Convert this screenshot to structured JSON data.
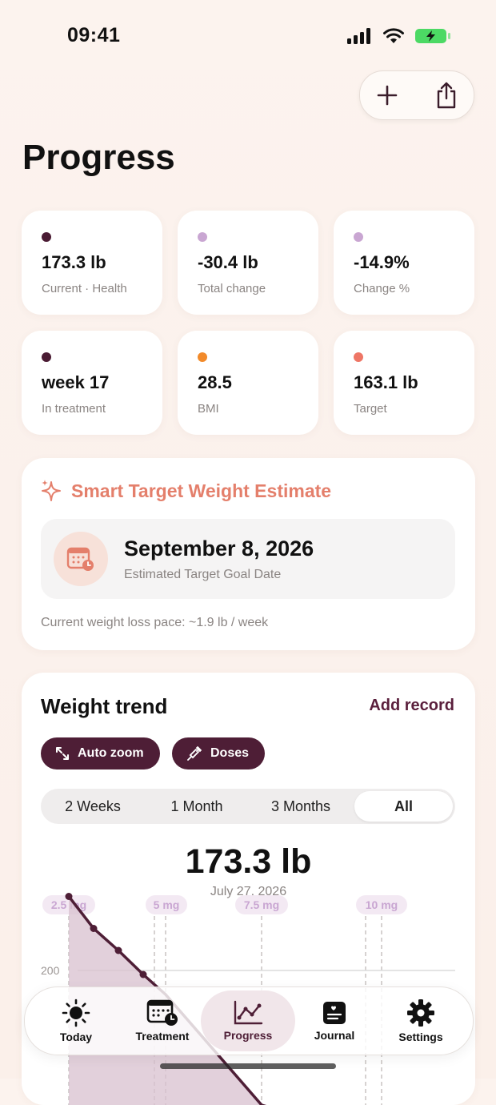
{
  "status_bar": {
    "time": "09:41"
  },
  "header": {
    "title": "Progress"
  },
  "stats": [
    {
      "value": "173.3 lb",
      "label": "Current · Health",
      "dot_color": "#4a1b33"
    },
    {
      "value": "-30.4 lb",
      "label": "Total change",
      "dot_color": "#c9a6d2"
    },
    {
      "value": "-14.9%",
      "label": "Change %",
      "dot_color": "#c9a6d2"
    },
    {
      "value": "week 17",
      "label": "In treatment",
      "dot_color": "#4a1b33"
    },
    {
      "value": "28.5",
      "label": "BMI",
      "dot_color": "#f28a2a"
    },
    {
      "value": "163.1 lb",
      "label": "Target",
      "dot_color": "#ee7666"
    }
  ],
  "smart_target": {
    "title": "Smart Target Weight Estimate",
    "date": "September 8, 2026",
    "date_label": "Estimated Target Goal Date",
    "pace": "Current weight loss pace: ~1.9 lb / week"
  },
  "weight_trend": {
    "title": "Weight trend",
    "add_record": "Add record",
    "chips": [
      "Auto zoom",
      "Doses"
    ],
    "ranges": [
      "2 Weeks",
      "1 Month",
      "3 Months",
      "All"
    ],
    "selected_range": "All",
    "current_value": "173.3 lb",
    "current_date": "July 27, 2026"
  },
  "chart_data": {
    "type": "area",
    "y_ticks": [
      "200"
    ],
    "dose_labels": [
      "2.5 mg",
      "5 mg",
      "7.5 mg",
      "10 mg"
    ],
    "series": [
      {
        "values": [
          203.7,
          202.1,
          201.0,
          199.8
        ]
      }
    ]
  },
  "tabbar": {
    "items": [
      {
        "label": "Today",
        "icon": "sun-icon"
      },
      {
        "label": "Treatment",
        "icon": "calendar-clock-icon"
      },
      {
        "label": "Progress",
        "icon": "chart-line-icon"
      },
      {
        "label": "Journal",
        "icon": "journal-icon"
      },
      {
        "label": "Settings",
        "icon": "gear-icon"
      }
    ],
    "active": "Progress"
  },
  "colors": {
    "accent": "#4e1e36",
    "smart": "#e47f6b"
  }
}
